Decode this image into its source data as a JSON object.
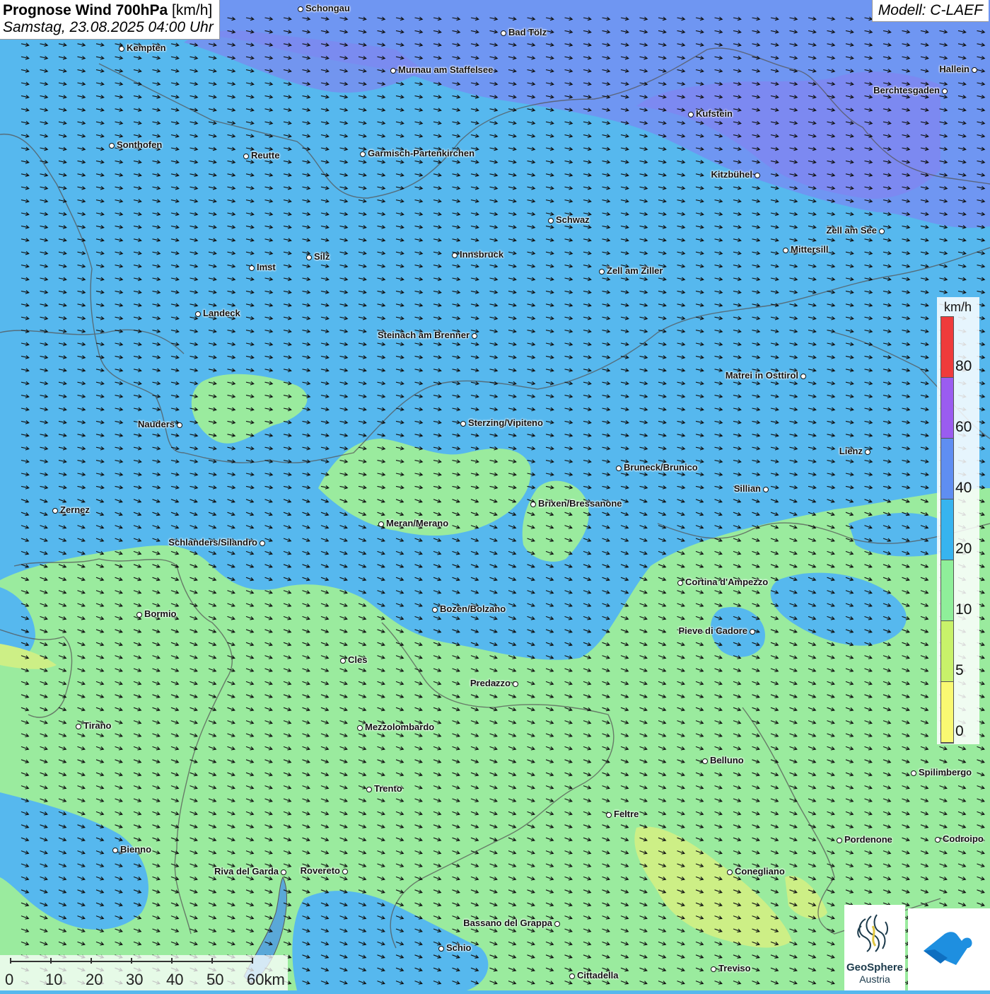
{
  "header": {
    "title_bold": "Prognose Wind 700hPa",
    "title_unit": "[km/h]",
    "datetime": "Samstag, 23.08.2025 04:00 Uhr",
    "model": "Modell: C-LAEF"
  },
  "legend": {
    "unit": "km/h",
    "ticks": [
      "80",
      "60",
      "40",
      "20",
      "10",
      "5",
      "0"
    ],
    "colors": [
      "#ef3b3b",
      "#9a5cf0",
      "#5f8ef2",
      "#37b4ef",
      "#8fef9a",
      "#c8f26a",
      "#f9f972"
    ]
  },
  "map_colors": {
    "blue_high": "#6f96f2",
    "blue_mid": "#56b8ee",
    "green": "#9aeb9e",
    "yellow_green": "#cdef86",
    "purple": "#7a7ef0"
  },
  "scale_bar": {
    "labels": [
      "0",
      "10",
      "20",
      "30",
      "40",
      "50",
      "60km"
    ]
  },
  "logo": {
    "name_line1": "GeoSphere",
    "name_line2": "Austria"
  },
  "cities": [
    {
      "name": "Schongau"
    },
    {
      "name": "Bad Tölz"
    },
    {
      "name": "Kempten"
    },
    {
      "name": "Murnau am Staffelsee"
    },
    {
      "name": "Hallein"
    },
    {
      "name": "Berchtesgaden"
    },
    {
      "name": "Kufstein"
    },
    {
      "name": "Sonthofen"
    },
    {
      "name": "Reutte"
    },
    {
      "name": "Garmisch-Partenkirchen"
    },
    {
      "name": "Kitzbühel"
    },
    {
      "name": "Schwaz"
    },
    {
      "name": "Zell am See"
    },
    {
      "name": "Mittersill"
    },
    {
      "name": "Silz"
    },
    {
      "name": "Innsbruck"
    },
    {
      "name": "Imst"
    },
    {
      "name": "Zell am Ziller"
    },
    {
      "name": "Landeck"
    },
    {
      "name": "Steinach am Brenner"
    },
    {
      "name": "Matrei in Osttirol"
    },
    {
      "name": "Nauders"
    },
    {
      "name": "Sterzing/Vipiteno"
    },
    {
      "name": "Lienz"
    },
    {
      "name": "Bruneck/Brunico"
    },
    {
      "name": "Sillian"
    },
    {
      "name": "Brixen/Bressanone"
    },
    {
      "name": "Zernez"
    },
    {
      "name": "Meran/Merano"
    },
    {
      "name": "Schlanders/Silandro"
    },
    {
      "name": "Cortina d'Ampezzo"
    },
    {
      "name": "Bozen/Bolzano"
    },
    {
      "name": "Bormio"
    },
    {
      "name": "Pieve di Cadore"
    },
    {
      "name": "Cles"
    },
    {
      "name": "Predazzo"
    },
    {
      "name": "Tirano"
    },
    {
      "name": "Mezzolombardo"
    },
    {
      "name": "Belluno"
    },
    {
      "name": "Spilimbergo"
    },
    {
      "name": "Trento"
    },
    {
      "name": "Feltre"
    },
    {
      "name": "Pordenone"
    },
    {
      "name": "Codroipo"
    },
    {
      "name": "Bienno"
    },
    {
      "name": "Riva del Garda"
    },
    {
      "name": "Rovereto"
    },
    {
      "name": "Conegliano"
    },
    {
      "name": "Bassano del Grappa"
    },
    {
      "name": "Schio"
    },
    {
      "name": "Treviso"
    },
    {
      "name": "Cittadella"
    }
  ]
}
